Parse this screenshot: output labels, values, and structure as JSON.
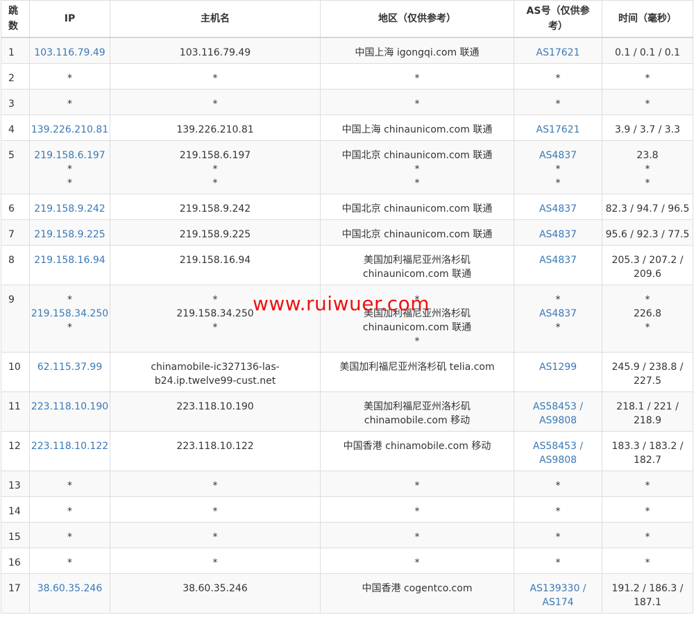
{
  "headers": {
    "hop": "跳数",
    "ip": "IP",
    "host": "主机名",
    "region": "地区（仅供参考）",
    "asn": "AS号（仅供参考）",
    "time": "时间（毫秒）"
  },
  "rows": [
    {
      "hop": "1",
      "ip": [
        "103.116.79.49"
      ],
      "host": [
        "103.116.79.49"
      ],
      "region": [
        "中国上海 igongqi.com 联通"
      ],
      "asn": [
        "AS17621"
      ],
      "time": [
        "0.1 / 0.1 / 0.1"
      ]
    },
    {
      "hop": "2",
      "ip": [
        "*"
      ],
      "host": [
        "*"
      ],
      "region": [
        "*"
      ],
      "asn": [
        "*"
      ],
      "time": [
        "*"
      ]
    },
    {
      "hop": "3",
      "ip": [
        "*"
      ],
      "host": [
        "*"
      ],
      "region": [
        "*"
      ],
      "asn": [
        "*"
      ],
      "time": [
        "*"
      ]
    },
    {
      "hop": "4",
      "ip": [
        "139.226.210.81"
      ],
      "host": [
        "139.226.210.81"
      ],
      "region": [
        "中国上海 chinaunicom.com 联通"
      ],
      "asn": [
        "AS17621"
      ],
      "time": [
        "3.9 / 3.7 / 3.3"
      ]
    },
    {
      "hop": "5",
      "ip": [
        "219.158.6.197",
        "*",
        "*"
      ],
      "host": [
        "219.158.6.197",
        "*",
        "*"
      ],
      "region": [
        "中国北京 chinaunicom.com 联通",
        "*",
        "*"
      ],
      "asn": [
        "AS4837",
        "*",
        "*"
      ],
      "time": [
        "23.8",
        "*",
        "*"
      ]
    },
    {
      "hop": "6",
      "ip": [
        "219.158.9.242"
      ],
      "host": [
        "219.158.9.242"
      ],
      "region": [
        "中国北京 chinaunicom.com 联通"
      ],
      "asn": [
        "AS4837"
      ],
      "time": [
        "82.3 / 94.7 / 96.5"
      ]
    },
    {
      "hop": "7",
      "ip": [
        "219.158.9.225"
      ],
      "host": [
        "219.158.9.225"
      ],
      "region": [
        "中国北京 chinaunicom.com 联通"
      ],
      "asn": [
        "AS4837"
      ],
      "time": [
        "95.6 / 92.3 / 77.5"
      ]
    },
    {
      "hop": "8",
      "ip": [
        "219.158.16.94"
      ],
      "host": [
        "219.158.16.94"
      ],
      "region": [
        "美国加利福尼亚州洛杉矶",
        "chinaunicom.com 联通"
      ],
      "asn": [
        "AS4837"
      ],
      "time": [
        "205.3 / 207.2 /",
        "209.6"
      ]
    },
    {
      "hop": "9",
      "ip": [
        "*",
        "219.158.34.250",
        "*"
      ],
      "host": [
        "*",
        "219.158.34.250",
        "*"
      ],
      "region": [
        "*",
        "美国加利福尼亚州洛杉矶",
        "chinaunicom.com 联通",
        "*"
      ],
      "asn": [
        "*",
        "AS4837",
        "*"
      ],
      "time": [
        "*",
        "226.8",
        "*"
      ]
    },
    {
      "hop": "10",
      "ip": [
        "62.115.37.99"
      ],
      "host": [
        "chinamobile-ic327136-las-",
        "b24.ip.twelve99-cust.net"
      ],
      "region": [
        "美国加利福尼亚州洛杉矶 telia.com"
      ],
      "asn": [
        "AS1299"
      ],
      "time": [
        "245.9 / 238.8 /",
        "227.5"
      ]
    },
    {
      "hop": "11",
      "ip": [
        "223.118.10.190"
      ],
      "host": [
        "223.118.10.190"
      ],
      "region": [
        "美国加利福尼亚州洛杉矶",
        "chinamobile.com 移动"
      ],
      "asn": [
        "AS58453 /",
        "AS9808"
      ],
      "time": [
        "218.1 / 221 /",
        "218.9"
      ]
    },
    {
      "hop": "12",
      "ip": [
        "223.118.10.122"
      ],
      "host": [
        "223.118.10.122"
      ],
      "region": [
        "中国香港 chinamobile.com 移动"
      ],
      "asn": [
        "AS58453 /",
        "AS9808"
      ],
      "time": [
        "183.3 / 183.2 /",
        "182.7"
      ]
    },
    {
      "hop": "13",
      "ip": [
        "*"
      ],
      "host": [
        "*"
      ],
      "region": [
        "*"
      ],
      "asn": [
        "*"
      ],
      "time": [
        "*"
      ]
    },
    {
      "hop": "14",
      "ip": [
        "*"
      ],
      "host": [
        "*"
      ],
      "region": [
        "*"
      ],
      "asn": [
        "*"
      ],
      "time": [
        "*"
      ]
    },
    {
      "hop": "15",
      "ip": [
        "*"
      ],
      "host": [
        "*"
      ],
      "region": [
        "*"
      ],
      "asn": [
        "*"
      ],
      "time": [
        "*"
      ]
    },
    {
      "hop": "16",
      "ip": [
        "*"
      ],
      "host": [
        "*"
      ],
      "region": [
        "*"
      ],
      "asn": [
        "*"
      ],
      "time": [
        "*"
      ]
    },
    {
      "hop": "17",
      "ip": [
        "38.60.35.246"
      ],
      "host": [
        "38.60.35.246"
      ],
      "region": [
        "中国香港 cogentco.com"
      ],
      "asn": [
        "AS139330 /",
        "AS174"
      ],
      "time": [
        "191.2 / 186.3 /",
        "187.1"
      ]
    }
  ],
  "watermark": "www.ruiwuer.com",
  "colors": {
    "link": "#3a78b7",
    "watermark": "#ee1111",
    "row_alt": "#f9f9f9",
    "border": "#dddddd"
  }
}
